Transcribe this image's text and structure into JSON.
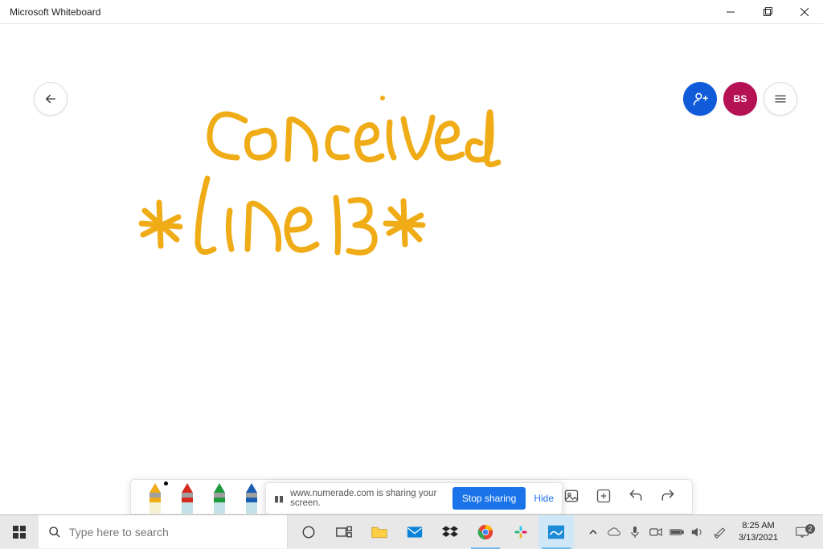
{
  "window": {
    "title": "Microsoft Whiteboard"
  },
  "header": {
    "avatar_initials": "BS"
  },
  "ink": {
    "color": "#f0ac17",
    "text1": "conceived",
    "text2": "* line 13 *"
  },
  "pens": [
    {
      "name": "pen-yellow",
      "tip": "#f0ac17",
      "body": "#f5f0d0",
      "band": "#f0ac17",
      "active": true
    },
    {
      "name": "pen-red",
      "tip": "#d52b1e",
      "body": "#c5e1e8",
      "band": "#d52b1e",
      "active": false
    },
    {
      "name": "pen-green",
      "tip": "#1f9b3c",
      "body": "#c5e1e8",
      "band": "#1f9b3c",
      "active": false
    },
    {
      "name": "pen-blue",
      "tip": "#1a5fb4",
      "body": "#c5e1e8",
      "band": "#1a5fb4",
      "active": false
    }
  ],
  "share": {
    "text": "www.numerade.com is sharing your screen.",
    "stop_label": "Stop sharing",
    "hide_label": "Hide"
  },
  "taskbar": {
    "search_placeholder": "Type here to search",
    "time": "8:25 AM",
    "date": "3/13/2021",
    "notif_count": "2"
  }
}
